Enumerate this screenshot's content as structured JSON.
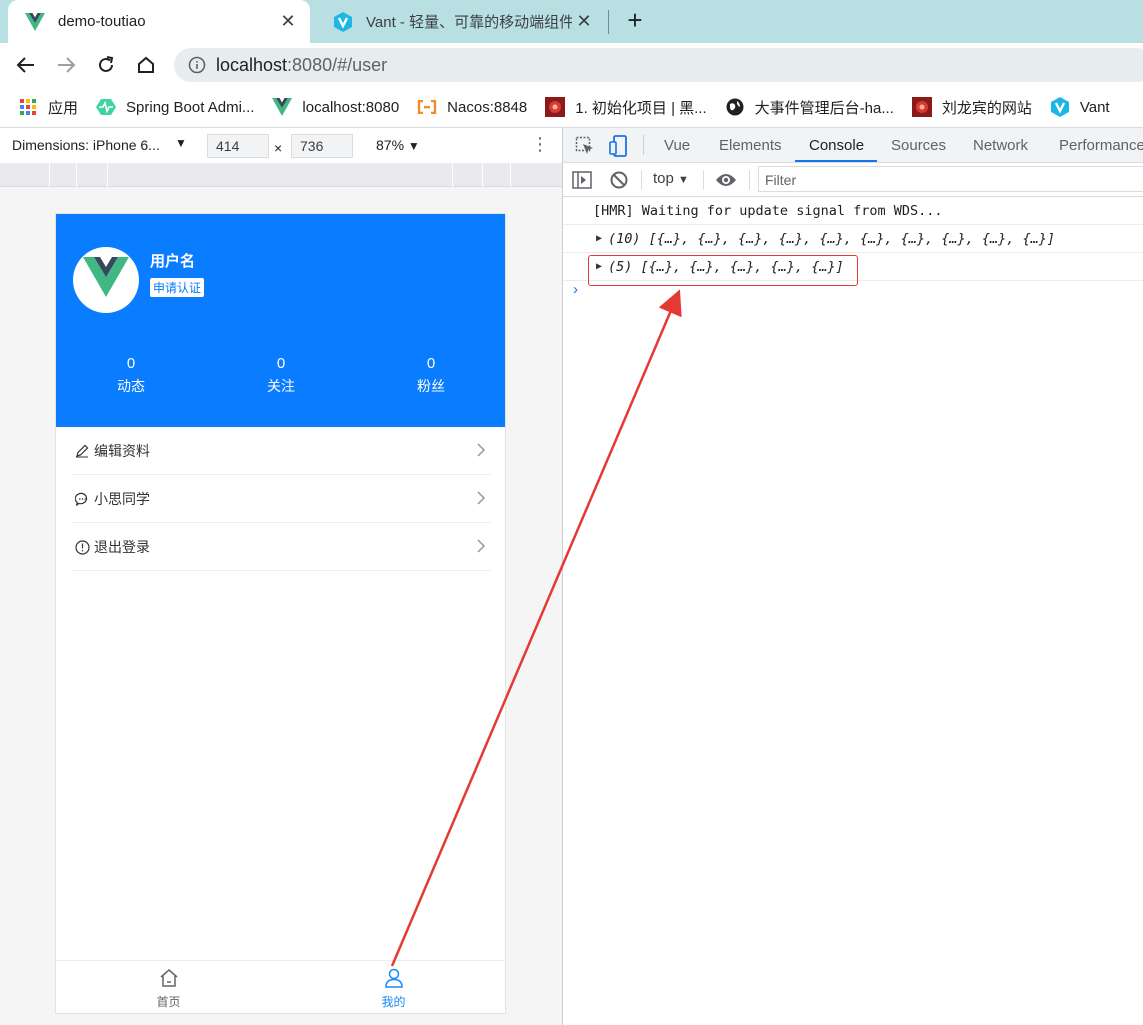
{
  "browser": {
    "tabs": [
      {
        "title": "demo-toutiao",
        "active": true
      },
      {
        "title": "Vant - 轻量、可靠的移动端组件库",
        "active": false
      }
    ],
    "new_tab_symbol": "+",
    "address": {
      "host": "localhost",
      "rest": ":8080/#/user"
    },
    "bookmarks": [
      {
        "label": "应用",
        "icon": "apps-grid-icon"
      },
      {
        "label": "Spring Boot Admi...",
        "icon": "spring-boot-admin-icon"
      },
      {
        "label": "localhost:8080",
        "icon": "vue-logo-icon"
      },
      {
        "label": "Nacos:8848",
        "icon": "nacos-icon"
      },
      {
        "label": "1. 初始化项目 | 黑...",
        "icon": "red-avatar-icon"
      },
      {
        "label": "大事件管理后台-ha...",
        "icon": "globe-icon"
      },
      {
        "label": "刘龙宾的网站",
        "icon": "red-avatar-icon"
      },
      {
        "label": "Vant",
        "icon": "vant-logo-icon"
      }
    ]
  },
  "device_toolbar": {
    "dimensions_label": "Dimensions: iPhone 6...",
    "width": "414",
    "times": "×",
    "height": "736",
    "zoom": "87%"
  },
  "app": {
    "user": {
      "name": "用户名",
      "verify_label": "申请认证",
      "stats": [
        {
          "count": "0",
          "label": "动态"
        },
        {
          "count": "0",
          "label": "关注"
        },
        {
          "count": "0",
          "label": "粉丝"
        }
      ]
    },
    "menu": [
      {
        "label": "编辑资料",
        "icon": "edit-icon"
      },
      {
        "label": "小思同学",
        "icon": "chat-icon"
      },
      {
        "label": "退出登录",
        "icon": "info-circle-icon"
      }
    ],
    "tabbar": [
      {
        "label": "首页",
        "icon": "home-icon",
        "active": false
      },
      {
        "label": "我的",
        "icon": "user-icon",
        "active": true
      }
    ]
  },
  "devtools": {
    "tabs": [
      "Vue",
      "Elements",
      "Console",
      "Sources",
      "Network",
      "Performance"
    ],
    "active_tab": "Console",
    "context": "top",
    "filter_placeholder": "Filter",
    "console_lines": [
      {
        "text": "[HMR] Waiting for update signal from WDS...",
        "expandable": false
      },
      {
        "text": "(10) [{…}, {…}, {…}, {…}, {…}, {…}, {…}, {…}, {…}, {…}]",
        "expandable": true
      },
      {
        "text": "(5) [{…}, {…}, {…}, {…}, {…}]",
        "expandable": true,
        "highlighted": true
      }
    ],
    "prompt_symbol": "›"
  },
  "annotation": {
    "color": "#e53935"
  }
}
